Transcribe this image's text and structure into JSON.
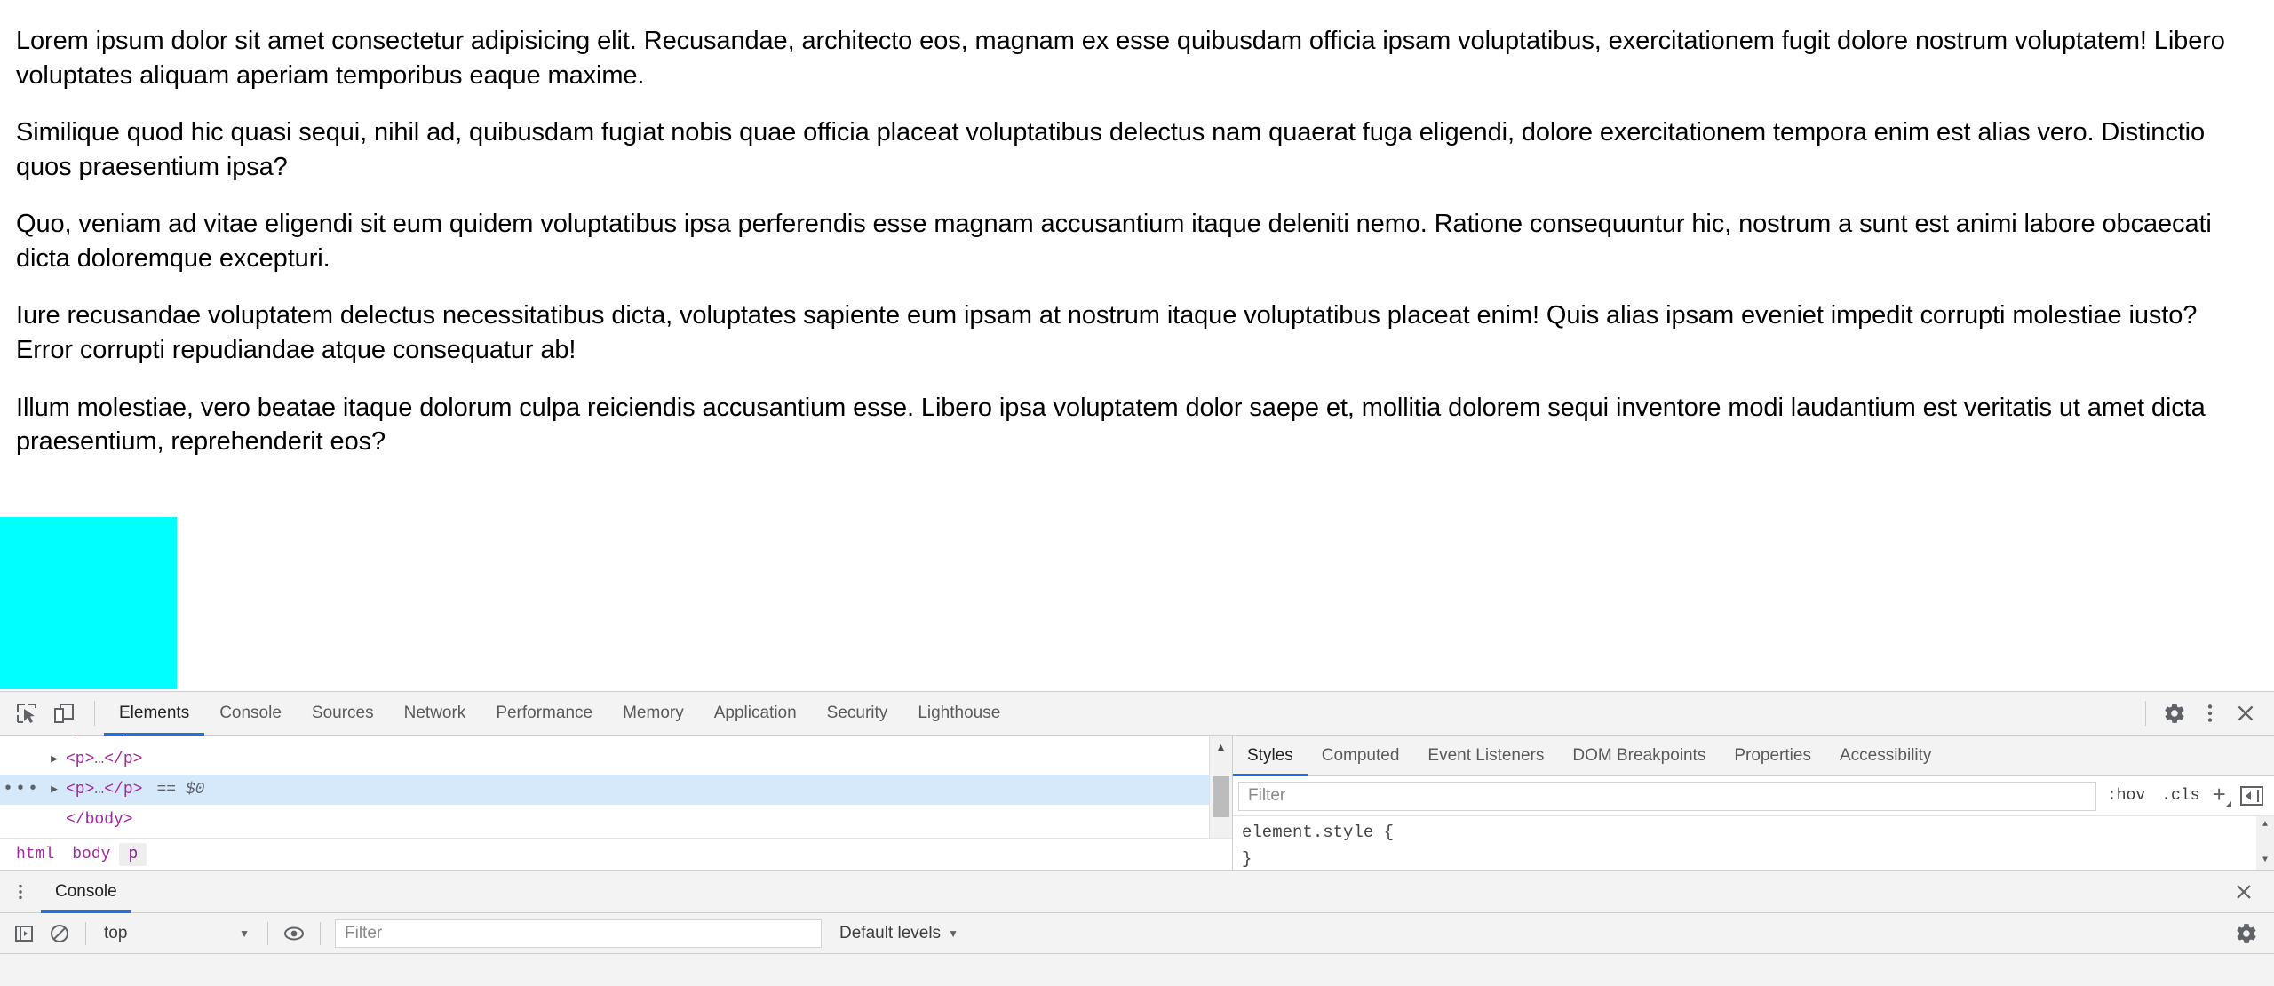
{
  "page": {
    "paragraphs": [
      "Lorem ipsum dolor sit amet consectetur adipisicing elit. Recusandae, architecto eos, magnam ex esse quibusdam officia ipsam voluptatibus, exercitationem fugit dolore nostrum voluptatem! Libero voluptates aliquam aperiam temporibus eaque maxime.",
      "Similique quod hic quasi sequi, nihil ad, quibusdam fugiat nobis quae officia placeat voluptatibus delectus nam quaerat fuga eligendi, dolore exercitationem tempora enim est alias vero. Distinctio quos praesentium ipsa?",
      "Quo, veniam ad vitae eligendi sit eum quidem voluptatibus ipsa perferendis esse magnam accusantium itaque deleniti nemo. Ratione consequuntur hic, nostrum a sunt est animi labore obcaecati dicta doloremque excepturi.",
      "Iure recusandae voluptatem delectus necessitatibus dicta, voluptates sapiente eum ipsam at nostrum itaque voluptatibus placeat enim! Quis alias ipsam eveniet impedit corrupti molestiae iusto? Error corrupti repudiandae atque consequatur ab!",
      "Illum molestiae, vero beatae itaque dolorum culpa reiciendis accusantium esse. Libero ipsa voluptatem dolor saepe et, mollitia dolorem sequi inventore modi laudantium est veritatis ut amet dicta praesentium, reprehenderit eos?"
    ],
    "highlight_color": "#00ffff"
  },
  "devtools": {
    "accent_color": "#1a73e8",
    "main_tabs": [
      {
        "label": "Elements",
        "active": true
      },
      {
        "label": "Console",
        "active": false
      },
      {
        "label": "Sources",
        "active": false
      },
      {
        "label": "Network",
        "active": false
      },
      {
        "label": "Performance",
        "active": false
      },
      {
        "label": "Memory",
        "active": false
      },
      {
        "label": "Application",
        "active": false
      },
      {
        "label": "Security",
        "active": false
      },
      {
        "label": "Lighthouse",
        "active": false
      }
    ],
    "dom_tree": {
      "rows": [
        {
          "indent": 1,
          "arrow": true,
          "dots": false,
          "open": "<p>",
          "ellipsis": "…",
          "close": "</p>",
          "suffix": "",
          "selected": false,
          "clipped": true
        },
        {
          "indent": 1,
          "arrow": true,
          "dots": false,
          "open": "<p>",
          "ellipsis": "…",
          "close": "</p>",
          "suffix": "",
          "selected": false,
          "clipped": false
        },
        {
          "indent": 1,
          "arrow": true,
          "dots": true,
          "open": "<p>",
          "ellipsis": "…",
          "close": "</p>",
          "suffix": "== $0",
          "selected": true,
          "clipped": false
        },
        {
          "indent": 1,
          "arrow": false,
          "dots": false,
          "open": "</body>",
          "ellipsis": "",
          "close": "",
          "suffix": "",
          "selected": false,
          "clipped": false
        }
      ],
      "dots_label": "•••"
    },
    "breadcrumb": [
      {
        "label": "html",
        "active": false
      },
      {
        "label": "body",
        "active": false
      },
      {
        "label": "p",
        "active": true
      }
    ],
    "styles_panel": {
      "tabs": [
        {
          "label": "Styles",
          "active": true
        },
        {
          "label": "Computed",
          "active": false
        },
        {
          "label": "Event Listeners",
          "active": false
        },
        {
          "label": "DOM Breakpoints",
          "active": false
        },
        {
          "label": "Properties",
          "active": false
        },
        {
          "label": "Accessibility",
          "active": false
        }
      ],
      "filter_placeholder": "Filter",
      "filter_value": "",
      "hov_label": ":hov",
      "cls_label": ".cls",
      "rule_selector": "element.style {",
      "rule_close": "}"
    },
    "drawer": {
      "tab_label": "Console",
      "toolbar": {
        "context_value": "top",
        "filter_placeholder": "Filter",
        "filter_value": "",
        "levels_label": "Default levels"
      }
    },
    "icons": {
      "inspect": "inspect-element-icon",
      "device": "device-toolbar-icon",
      "settings": "gear-icon",
      "more": "kebab-menu-icon",
      "close": "close-icon",
      "console_sidebar": "console-sidebar-icon",
      "clear": "clear-console-icon",
      "eye": "live-expression-icon",
      "console_settings": "console-settings-icon"
    }
  }
}
